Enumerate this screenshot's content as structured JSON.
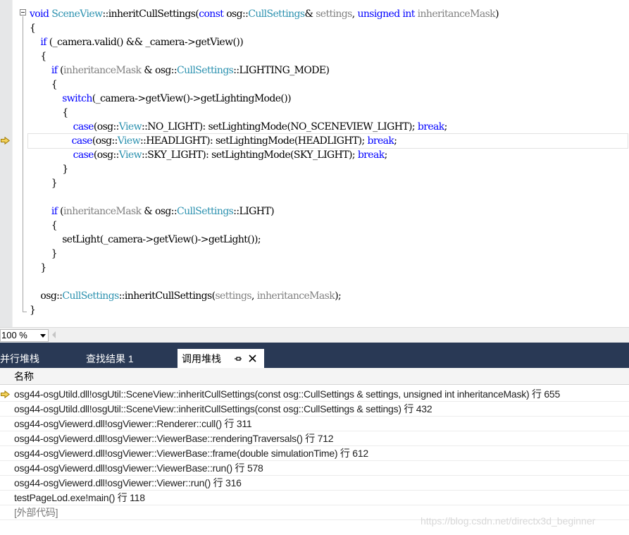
{
  "editor": {
    "lines": [
      [
        {
          "t": "void",
          "c": "kw"
        },
        {
          "t": " ",
          "c": "pl"
        },
        {
          "t": "SceneView",
          "c": "ty"
        },
        {
          "t": "::",
          "c": "pl"
        },
        {
          "t": "inheritCullSettings(",
          "c": "pl"
        },
        {
          "t": "const",
          "c": "kw"
        },
        {
          "t": " osg::",
          "c": "pl"
        },
        {
          "t": "CullSettings",
          "c": "ty"
        },
        {
          "t": "& ",
          "c": "pl"
        },
        {
          "t": "settings",
          "c": "pm"
        },
        {
          "t": ", ",
          "c": "pl"
        },
        {
          "t": "unsigned",
          "c": "kw"
        },
        {
          "t": " ",
          "c": "pl"
        },
        {
          "t": "int",
          "c": "kw"
        },
        {
          "t": " ",
          "c": "pl"
        },
        {
          "t": "inheritanceMask",
          "c": "pm"
        },
        {
          "t": ")",
          "c": "pl"
        }
      ],
      [
        {
          "t": "{",
          "c": "pl"
        }
      ],
      [
        {
          "t": "    ",
          "c": "pl"
        },
        {
          "t": "if",
          "c": "kw"
        },
        {
          "t": " (_camera.valid() && _camera->getView())",
          "c": "pl"
        }
      ],
      [
        {
          "t": "    {",
          "c": "pl"
        }
      ],
      [
        {
          "t": "        ",
          "c": "pl"
        },
        {
          "t": "if",
          "c": "kw"
        },
        {
          "t": " (",
          "c": "pl"
        },
        {
          "t": "inheritanceMask",
          "c": "pm"
        },
        {
          "t": " & osg::",
          "c": "pl"
        },
        {
          "t": "CullSettings",
          "c": "ty"
        },
        {
          "t": "::LIGHTING_MODE)",
          "c": "pl"
        }
      ],
      [
        {
          "t": "        {",
          "c": "pl"
        }
      ],
      [
        {
          "t": "            ",
          "c": "pl"
        },
        {
          "t": "switch",
          "c": "kw"
        },
        {
          "t": "(_camera->getView()->getLightingMode())",
          "c": "pl"
        }
      ],
      [
        {
          "t": "            {",
          "c": "pl"
        }
      ],
      [
        {
          "t": "                ",
          "c": "pl"
        },
        {
          "t": "case",
          "c": "kw"
        },
        {
          "t": "(osg::",
          "c": "pl"
        },
        {
          "t": "View",
          "c": "ty"
        },
        {
          "t": "::NO_LIGHT): setLightingMode(NO_SCENEVIEW_LIGHT); ",
          "c": "pl"
        },
        {
          "t": "break",
          "c": "kw"
        },
        {
          "t": ";",
          "c": "pl"
        }
      ],
      [
        {
          "t": "                ",
          "c": "pl"
        },
        {
          "t": "case",
          "c": "kw"
        },
        {
          "t": "(osg::",
          "c": "pl"
        },
        {
          "t": "View",
          "c": "ty"
        },
        {
          "t": "::HEADLIGHT): setLightingMode(HEADLIGHT); ",
          "c": "pl"
        },
        {
          "t": "break",
          "c": "kw"
        },
        {
          "t": ";",
          "c": "pl"
        }
      ],
      [
        {
          "t": "                ",
          "c": "pl"
        },
        {
          "t": "case",
          "c": "kw"
        },
        {
          "t": "(osg::",
          "c": "pl"
        },
        {
          "t": "View",
          "c": "ty"
        },
        {
          "t": "::SKY_LIGHT): setLightingMode(SKY_LIGHT); ",
          "c": "pl"
        },
        {
          "t": "break",
          "c": "kw"
        },
        {
          "t": ";",
          "c": "pl"
        }
      ],
      [
        {
          "t": "            }",
          "c": "pl"
        }
      ],
      [
        {
          "t": "        }",
          "c": "pl"
        }
      ],
      [],
      [
        {
          "t": "        ",
          "c": "pl"
        },
        {
          "t": "if",
          "c": "kw"
        },
        {
          "t": " (",
          "c": "pl"
        },
        {
          "t": "inheritanceMask",
          "c": "pm"
        },
        {
          "t": " & osg::",
          "c": "pl"
        },
        {
          "t": "CullSettings",
          "c": "ty"
        },
        {
          "t": "::LIGHT)",
          "c": "pl"
        }
      ],
      [
        {
          "t": "        {",
          "c": "pl"
        }
      ],
      [
        {
          "t": "            setLight(_camera->getView()->getLight());",
          "c": "pl"
        }
      ],
      [
        {
          "t": "        }",
          "c": "pl"
        }
      ],
      [
        {
          "t": "    }",
          "c": "pl"
        }
      ],
      [],
      [
        {
          "t": "    osg::",
          "c": "pl"
        },
        {
          "t": "CullSettings",
          "c": "ty"
        },
        {
          "t": "::inheritCullSettings(",
          "c": "pl"
        },
        {
          "t": "settings",
          "c": "pm"
        },
        {
          "t": ", ",
          "c": "pl"
        },
        {
          "t": "inheritanceMask",
          "c": "pm"
        },
        {
          "t": ");",
          "c": "pl"
        }
      ],
      [
        {
          "t": "}",
          "c": "pl"
        }
      ]
    ],
    "current_line_index": 9
  },
  "zoom": {
    "label": "100 %"
  },
  "tabs": {
    "parallel_stacks": "并行堆栈",
    "find_results": "查找结果 1",
    "call_stack": "调用堆栈"
  },
  "call_stack": {
    "column_name": "名称",
    "current_frame_index": 0,
    "frames": [
      "osg44-osgUtild.dll!osgUtil::SceneView::inheritCullSettings(const osg::CullSettings & settings, unsigned int inheritanceMask) 行 655",
      "osg44-osgUtild.dll!osgUtil::SceneView::inheritCullSettings(const osg::CullSettings & settings) 行 432",
      "osg44-osgViewerd.dll!osgViewer::Renderer::cull() 行 311",
      "osg44-osgViewerd.dll!osgViewer::ViewerBase::renderingTraversals() 行 712",
      "osg44-osgViewerd.dll!osgViewer::ViewerBase::frame(double simulationTime) 行 612",
      "osg44-osgViewerd.dll!osgViewer::ViewerBase::run() 行 578",
      "osg44-osgViewerd.dll!osgViewer::Viewer::run() 行 316",
      "testPageLod.exe!main() 行 118",
      "[外部代码]"
    ],
    "external_frame_index": 8
  },
  "watermark": "https://blog.csdn.net/directx3d_beginner",
  "colors": {
    "keyword": "#0000ff",
    "type": "#2b91af",
    "parameter": "#808080",
    "tool_window_header": "#293955",
    "exec_arrow": "#f4d35e"
  },
  "icons": {
    "execution_pointer": "exec-arrow-icon",
    "collapse": "collapse-minus-icon",
    "pin": "pin-icon",
    "close": "close-icon",
    "dropdown": "chevron-down-icon"
  }
}
